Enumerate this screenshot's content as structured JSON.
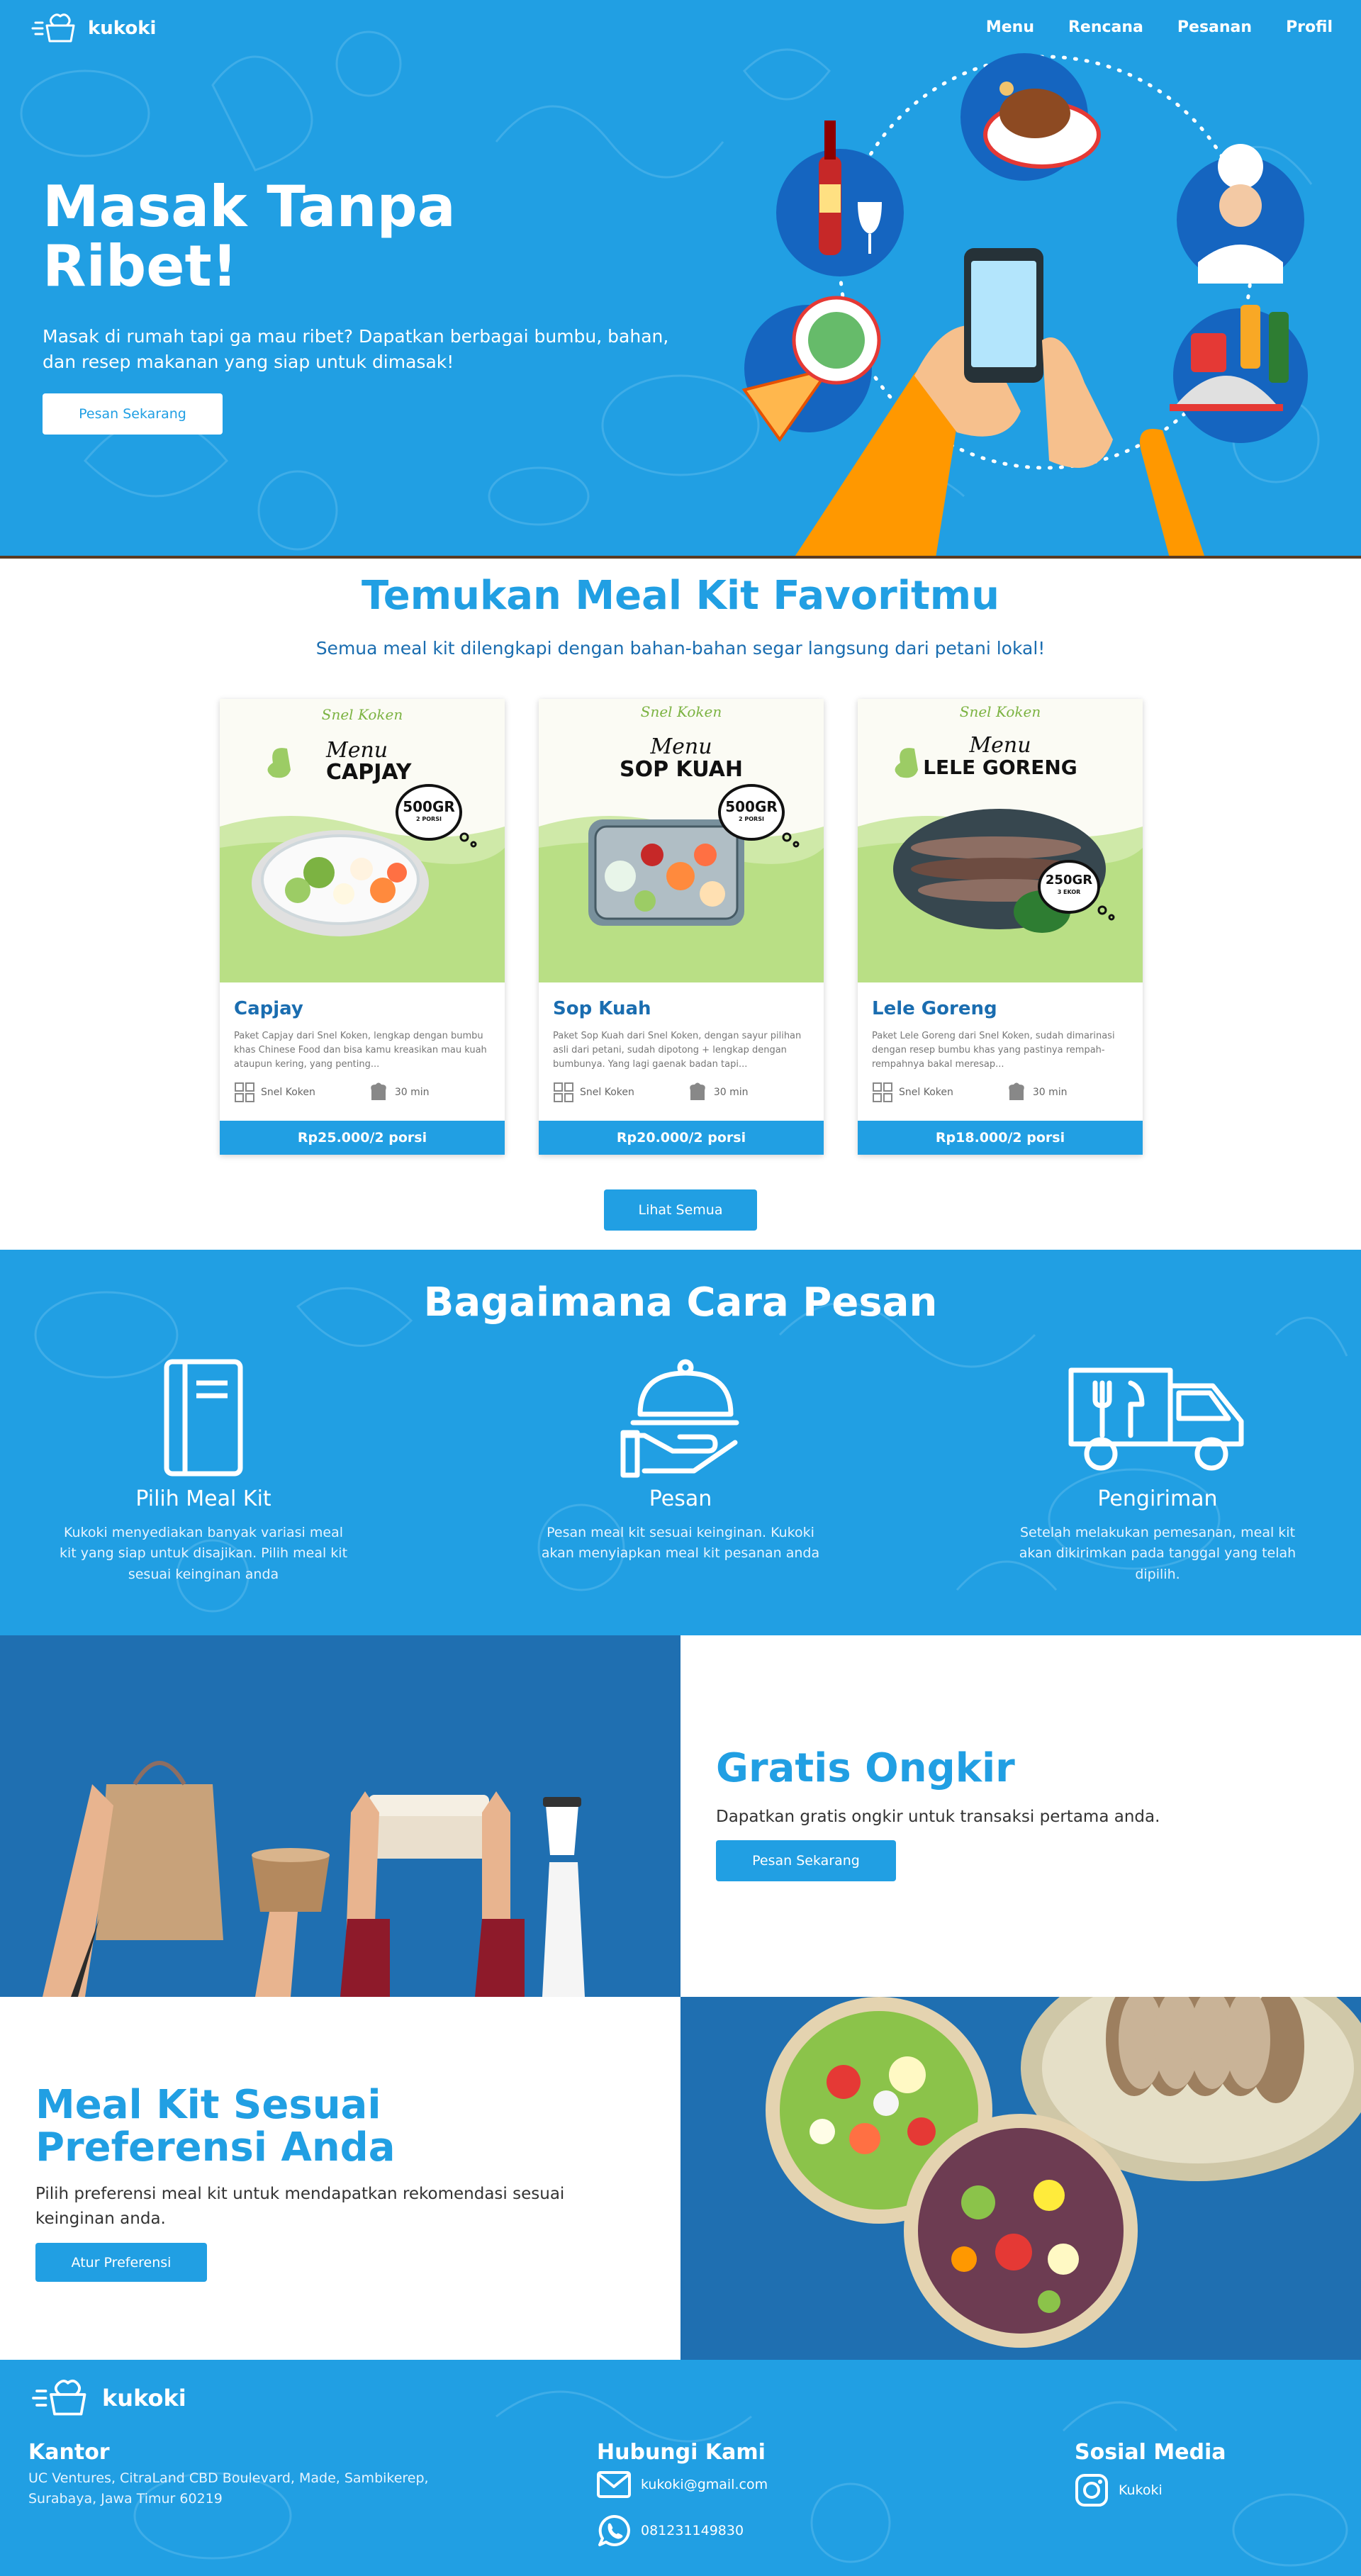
{
  "brand": {
    "name": "kukoki"
  },
  "nav": {
    "items": [
      "Menu",
      "Rencana",
      "Pesanan",
      "Profil"
    ]
  },
  "hero": {
    "title": "Masak Tanpa Ribet!",
    "subtitle": "Masak di rumah tapi ga mau ribet? Dapatkan berbagai bumbu, bahan, dan resep makanan yang siap untuk dimasak!",
    "cta": "Pesan Sekarang"
  },
  "mealkits": {
    "title": "Temukan Meal Kit Favoritmu",
    "subtitle": "Semua meal kit dilengkapi dengan bahan-bahan segar langsung dari petani lokal!",
    "cards": [
      {
        "brand": "Snel Koken",
        "menu_word": "Menu",
        "menu_name": "CAPJAY",
        "weight": "500GR",
        "portion_tag": "2 PORSI",
        "name": "Capjay",
        "desc": "Paket Capjay dari Snel Koken, lengkap dengan bumbu khas Chinese Food dan bisa kamu kreasikan mau kuah ataupun kering, yang penting...",
        "seller": "Snel Koken",
        "time": "30 min",
        "price": "Rp25.000/2 porsi"
      },
      {
        "brand": "Snel Koken",
        "menu_word": "Menu",
        "menu_name": "SOP KUAH",
        "weight": "500GR",
        "portion_tag": "2 PORSI",
        "name": "Sop Kuah",
        "desc": "Paket Sop Kuah dari Snel Koken, dengan sayur pilihan asli dari petani, sudah dipotong + lengkap dengan bumbunya. Yang lagi gaenak badan tapi...",
        "seller": "Snel Koken",
        "time": "30 min",
        "price": "Rp20.000/2 porsi"
      },
      {
        "brand": "Snel Koken",
        "menu_word": "Menu",
        "menu_name": "LELE GORENG",
        "weight": "250GR",
        "portion_tag": "3 EKOR",
        "name": "Lele Goreng",
        "desc": "Paket Lele Goreng dari Snel Koken, sudah dimarinasi dengan resep bumbu khas yang pastinya rempah-rempahnya bakal meresap...",
        "seller": "Snel Koken",
        "time": "30 min",
        "price": "Rp18.000/2 porsi"
      }
    ],
    "see_all": "Lihat Semua"
  },
  "how": {
    "title": "Bagaimana Cara Pesan",
    "steps": [
      {
        "name": "Pilih Meal Kit",
        "desc": "Kukoki menyediakan banyak variasi meal kit yang siap untuk disajikan. Pilih meal kit sesuai keinginan anda",
        "icon": "book-icon"
      },
      {
        "name": "Pesan",
        "desc": "Pesan meal kit sesuai keinginan. Kukoki akan menyiapkan meal kit pesanan anda",
        "icon": "serving-cloche-icon"
      },
      {
        "name": "Pengiriman",
        "desc": "Setelah melakukan pemesanan, meal kit akan dikirimkan pada tanggal yang telah dipilih.",
        "icon": "delivery-truck-icon"
      }
    ]
  },
  "promo": {
    "title": "Gratis Ongkir",
    "text": "Dapatkan gratis ongkir untuk transaksi pertama anda.",
    "cta": "Pesan Sekarang"
  },
  "preference": {
    "title": "Meal Kit Sesuai Preferensi Anda",
    "text": "Pilih preferensi meal kit untuk mendapatkan rekomendasi sesuai keinginan anda.",
    "cta": "Atur Preferensi"
  },
  "footer": {
    "office_title": "Kantor",
    "office_address": "UC Ventures, CitraLand CBD Boulevard, Made, Sambikerep, Surabaya, Jawa Timur 60219",
    "contact_title": "Hubungi Kami",
    "email": "kukoki@gmail.com",
    "phone": "081231149830",
    "social_title": "Sosial Media",
    "instagram": "Kukoki"
  },
  "colors": {
    "primary": "#219fe3",
    "dark_blue": "#1f6fb1",
    "title_blue": "#1a6db0"
  }
}
